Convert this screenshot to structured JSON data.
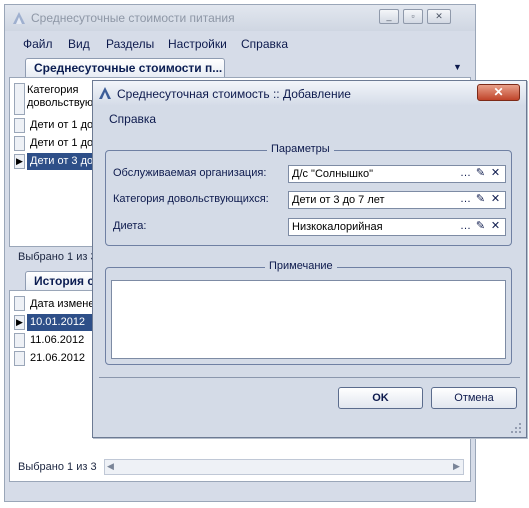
{
  "main_window": {
    "title": "Среднесуточные стоимости питания",
    "menu": [
      "Файл",
      "Вид",
      "Разделы",
      "Настройки",
      "Справка"
    ],
    "tab_top": "Среднесуточные стоимости п...",
    "grid_top": {
      "header": "Категория довольствующ",
      "rows": [
        "Дети от 1 до",
        "Дети от 1 до",
        "Дети от 3 до"
      ],
      "selected_index": 2
    },
    "status_top": "Выбрано 1 из 3",
    "tab_bottom": "История с",
    "grid_bottom": {
      "header": "Дата измене",
      "rows": [
        "10.01.2012",
        "11.06.2012",
        "21.06.2012"
      ],
      "selected_index": 0
    },
    "status_bottom": "Выбрано 1 из 3"
  },
  "dialog": {
    "title": "Среднесуточная стоимость :: Добавление",
    "close_symbol": "✕",
    "help_menu": "Справка",
    "params_group": "Параметры",
    "fields": [
      {
        "label": "Обслуживаемая организация:",
        "value": "Д/с \"Солнышко\""
      },
      {
        "label": "Категория довольствующихся:",
        "value": "Дети от 3 до 7 лет"
      },
      {
        "label": "Диета:",
        "value": "Низкокалорийная"
      }
    ],
    "note_group": "Примечание",
    "note_text": "",
    "ok_label": "OK",
    "cancel_label": "Отмена"
  },
  "icons": {
    "ellipsis": "…",
    "edit": "✎",
    "clear": "✕",
    "dropdown": "▼",
    "row_pointer": "▶",
    "minimize": "_",
    "restore": "▫",
    "close": "✕",
    "scroll_left": "◀",
    "scroll_right": "▶"
  },
  "colors": {
    "selection": "#2e4f88",
    "close_button": "#c0442a",
    "window_bg": "#d4dbe7"
  }
}
